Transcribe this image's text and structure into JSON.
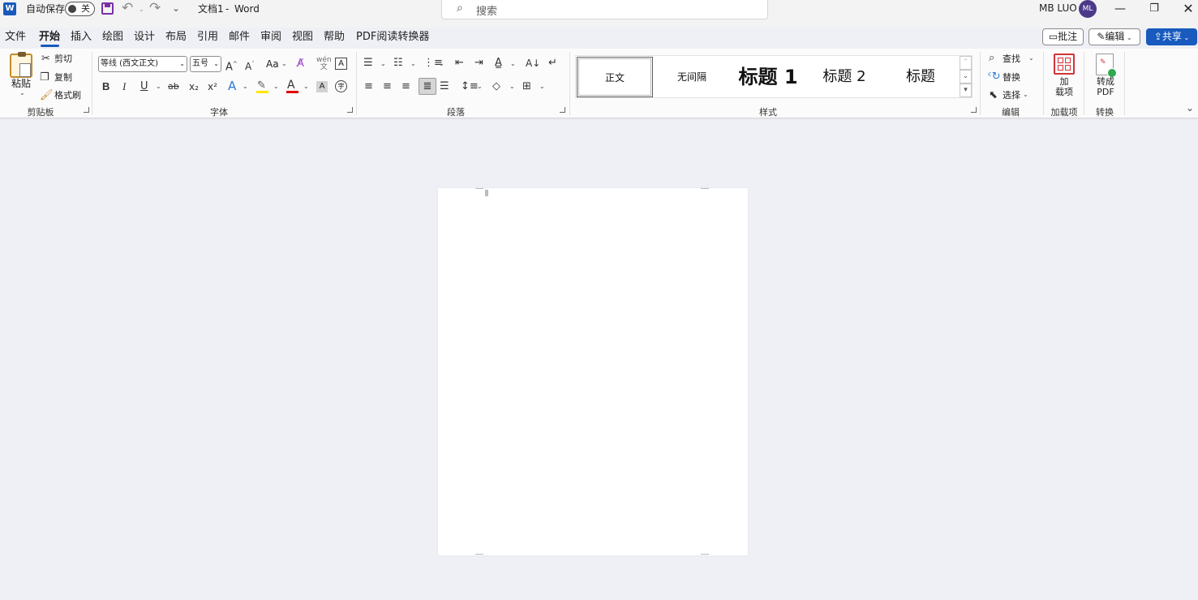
{
  "titlebar": {
    "app_badge": "W",
    "autosave_label": "自动保存",
    "autosave_state": "关",
    "doc_title": "文档1",
    "separator": "-",
    "app_name": "Word",
    "search_placeholder": "搜索",
    "user_name": "MB LUO",
    "user_initials": "ML"
  },
  "menu": {
    "tabs": [
      "文件",
      "开始",
      "插入",
      "绘图",
      "设计",
      "布局",
      "引用",
      "邮件",
      "审阅",
      "视图",
      "帮助",
      "PDF阅读转换器"
    ],
    "active_tab": "开始",
    "comments_label": "批注",
    "editing_label": "编辑",
    "share_label": "共享"
  },
  "ribbon": {
    "clipboard": {
      "paste": "粘贴",
      "cut": "剪切",
      "copy": "复制",
      "format_painter": "格式刷",
      "label": "剪贴板"
    },
    "font": {
      "font_name": "等线 (西文正文)",
      "font_size": "五号",
      "change_case": "Aa",
      "bold": "B",
      "italic": "I",
      "underline": "U",
      "strike": "ab",
      "subscript": "x₂",
      "superscript": "x²",
      "label": "字体"
    },
    "paragraph": {
      "label": "段落"
    },
    "styles": {
      "items": [
        "正文",
        "无间隔",
        "标题 1",
        "标题 2",
        "标题"
      ],
      "label": "样式"
    },
    "editing": {
      "find": "查找",
      "replace": "替换",
      "select": "选择",
      "label": "编辑"
    },
    "addins": {
      "button": "加\n载项",
      "label": "加载项"
    },
    "convert": {
      "button": "转成\nPDF",
      "label": "转换"
    }
  },
  "colors": {
    "accent": "#185abd",
    "highlight": "#ffe600",
    "font_color": "#e00000",
    "save_icon": "#7a2fa7",
    "addins_icon": "#d13438"
  }
}
